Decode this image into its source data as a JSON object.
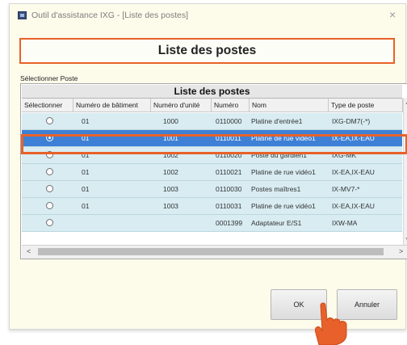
{
  "window": {
    "title": "Outil d'assistance IXG - [Liste des postes]",
    "close_glyph": "×"
  },
  "header": {
    "title": "Liste des postes"
  },
  "select_label": "Sélectionner Poste",
  "table": {
    "title": "Liste des postes",
    "columns": [
      "Sélectionner",
      "Numéro de bâtiment",
      "Numéro d'unité",
      "Numéro",
      "Nom",
      "Type de poste"
    ],
    "rows": [
      {
        "building": "01",
        "unit": "1000",
        "number": "0110000",
        "name": "Platine d'entrée1",
        "type": "IXG-DM7(-*)",
        "selected": false
      },
      {
        "building": "01",
        "unit": "1001",
        "number": "0110011",
        "name": "Platine de rue vidéo1",
        "type": "IX-EA,IX-EAU",
        "selected": true
      },
      {
        "building": "01",
        "unit": "1002",
        "number": "0110020",
        "name": "Poste du gardien1",
        "type": "IXG-MK",
        "selected": false
      },
      {
        "building": "01",
        "unit": "1002",
        "number": "0110021",
        "name": "Platine de rue vidéo1",
        "type": "IX-EA,IX-EAU",
        "selected": false
      },
      {
        "building": "01",
        "unit": "1003",
        "number": "0110030",
        "name": "Postes maîtres1",
        "type": "IX-MV7-*",
        "selected": false
      },
      {
        "building": "01",
        "unit": "1003",
        "number": "0110031",
        "name": "Platine de rue vidéo1",
        "type": "IX-EA,IX-EAU",
        "selected": false
      },
      {
        "building": "",
        "unit": "",
        "number": "0001399",
        "name": "Adaptateur E/S1",
        "type": "IXW-MA",
        "selected": false
      }
    ]
  },
  "buttons": {
    "ok": "OK",
    "cancel": "Annuler"
  },
  "colors": {
    "accent": "#e8612a",
    "selected_row": "#3d80d6",
    "row_bg": "#d8ecf2",
    "window_bg": "#fdfbea"
  },
  "icons": [
    "app-icon",
    "close-icon",
    "scroll-up-icon",
    "scroll-down-icon",
    "scroll-left-icon",
    "scroll-right-icon",
    "pointer-hand-icon"
  ]
}
